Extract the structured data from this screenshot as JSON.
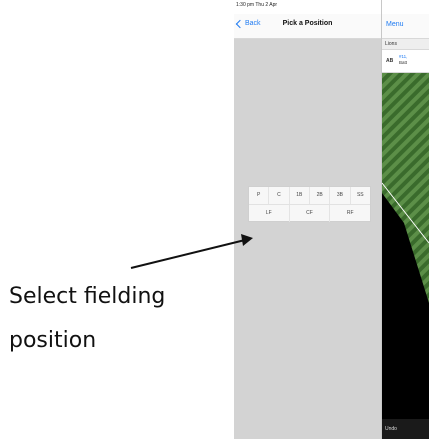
{
  "tablet": {
    "status_bar": "1:30 pm  Thu 2 Apr",
    "nav": {
      "back_label": "Back",
      "title": "Pick a Position"
    },
    "positions": {
      "infield": [
        "P",
        "C",
        "1B",
        "2B",
        "3B",
        "SS"
      ],
      "outfield": [
        "LF",
        "CF",
        "RF"
      ]
    },
    "right_pane": {
      "menu_label": "Menu",
      "team_name": "Lions",
      "ab_label": "AB",
      "batter_number": "#11,",
      "batter_name": "Batt",
      "undo_label": "Undo"
    },
    "colors": {
      "accent": "#1f7bf2",
      "panel_gray": "#d3d3d3",
      "grass_dark": "#3a6b2c",
      "grass_light": "#5c8f48"
    }
  },
  "annotation": {
    "line1": "Select fielding",
    "line2": "position",
    "arrow": "arrow-icon"
  }
}
